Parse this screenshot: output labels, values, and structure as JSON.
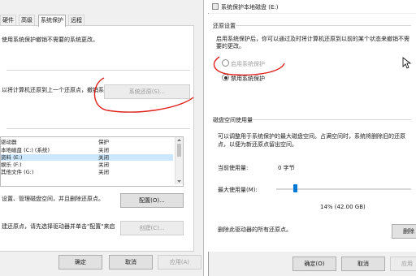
{
  "left": {
    "tabs": [
      "硬件",
      "高级",
      "系统保护",
      "远程"
    ],
    "top_text": "使用系统保护撤销不需要的系统更改。",
    "restore_text": "以将计算机还原到上一个还原点，撤销系",
    "restore_button": "系统还原(S)...",
    "table_headers": [
      "驱动器",
      "保护"
    ],
    "table_rows": [
      {
        "name": "本地磁盘 (C:) (系统)",
        "status": "关闭"
      },
      {
        "name": "资料 (E:)",
        "status": "关闭"
      },
      {
        "name": "娱乐 (F:)",
        "status": "关闭"
      },
      {
        "name": "其他文件 (G:)",
        "status": "关闭"
      }
    ],
    "config_text": "设置、管理磁盘空间，并且删除还原点。",
    "config_button": "配置(O)...",
    "create_text": "建还原点，请先选择驱动器并单击\"配置\"来启",
    "create_button": "创建(C)...",
    "ok": "确定",
    "cancel": "取消",
    "apply": "应用(A)"
  },
  "right": {
    "title": "系统保护本地磁盘 (E:)",
    "section_restore": "还原设置",
    "restore_desc": "启用系统保护后，你可以通过及时将计算机还原到以前的某个状态来撤销不需要的更改。",
    "option_enable": "启用系统保护",
    "option_disable": "禁用系统保护",
    "section_disk": "磁盘空间使用量",
    "disk_desc": "可以调整用于系统保护的最大磁盘空间。占满空间时，系统将删除旧的还原点，以便为新还原点留出空间。",
    "current_label": "当前使用量:",
    "current_value": "0 字节",
    "max_label": "最大使用量(M):",
    "max_value": "14% (42.00 GB)",
    "max_fraction": 0.14,
    "delete_text": "删除此驱动器的所有还原点。",
    "delete_button": "删除",
    "ok": "确定(O)",
    "cancel": "取消",
    "apply": "应用"
  }
}
